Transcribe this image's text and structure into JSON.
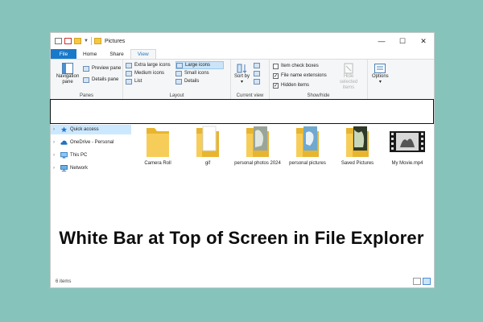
{
  "window": {
    "title": "Pictures",
    "controls": {
      "minimize": "—",
      "maximize": "☐",
      "close": "✕"
    }
  },
  "tabs": [
    {
      "label": "File"
    },
    {
      "label": "Home"
    },
    {
      "label": "Share"
    },
    {
      "label": "View"
    }
  ],
  "ribbon": {
    "panes": {
      "label": "Panes",
      "navigation_pane": "Navigation pane",
      "preview_pane": "Preview pane",
      "details_pane": "Details pane"
    },
    "layout": {
      "label": "Layout",
      "options": [
        "Extra large icons",
        "Large icons",
        "Medium icons",
        "Small icons",
        "List",
        "Details"
      ],
      "selected": "Large icons"
    },
    "current_view": {
      "label": "Current view",
      "sort_by": "Sort by"
    },
    "show_hide": {
      "label": "Show/hide",
      "item_check_boxes": "Item check boxes",
      "file_name_extensions": "File name extensions",
      "hidden_items": "Hidden items",
      "hide_selected_items": "Hide selected items"
    },
    "options": {
      "label": "Options"
    }
  },
  "nav": {
    "items": [
      {
        "label": "Quick access",
        "icon": "star-icon"
      },
      {
        "label": "OneDrive - Personal",
        "icon": "cloud-icon"
      },
      {
        "label": "This PC",
        "icon": "computer-icon"
      },
      {
        "label": "Network",
        "icon": "network-icon"
      }
    ]
  },
  "files": [
    {
      "name": "Camera Roll",
      "kind": "folder"
    },
    {
      "name": "gif",
      "kind": "folder-doc"
    },
    {
      "name": "personal photos 2024",
      "kind": "folder-photo"
    },
    {
      "name": "personal pictures",
      "kind": "folder-photo-blue"
    },
    {
      "name": "Saved Pictures",
      "kind": "folder-photo-green"
    },
    {
      "name": "My Movie.mp4",
      "kind": "video"
    }
  ],
  "status": {
    "item_count": "6 items"
  },
  "caption": "White Bar at Top of Screen in File Explorer",
  "colors": {
    "accent": "#1979ca",
    "background": "#86c4bb",
    "folder": "#f5c842"
  }
}
